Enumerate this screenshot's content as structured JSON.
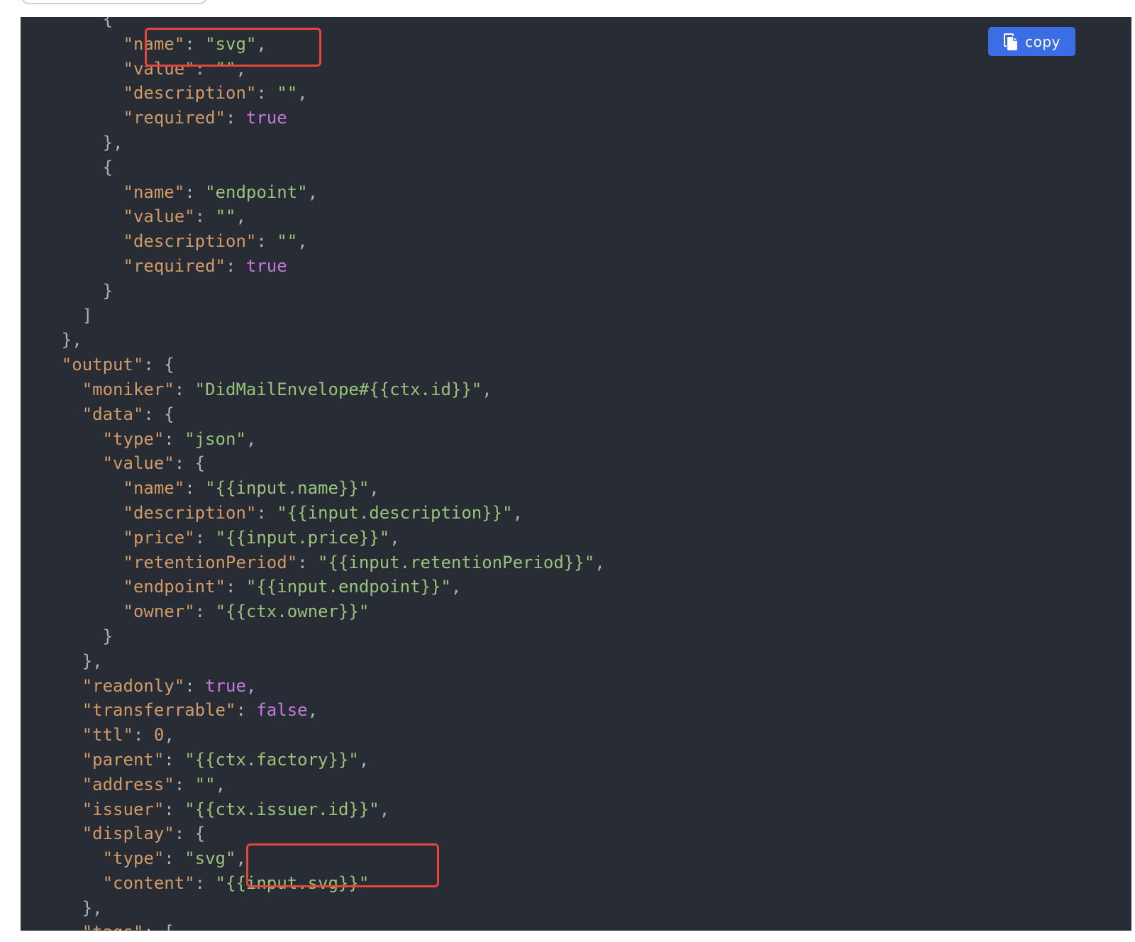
{
  "copy_button": {
    "label": "copy",
    "icon": "copy-icon",
    "color": "#3b6ee6"
  },
  "highlight_color": "#e8443a",
  "code": {
    "language": "json",
    "lines": [
      [
        {
          "t": "p",
          "v": "        {"
        }
      ],
      [
        {
          "t": "p",
          "v": "          "
        },
        {
          "t": "k",
          "v": "\"name\""
        },
        {
          "t": "p",
          "v": ": "
        },
        {
          "t": "s",
          "v": "\"svg\""
        },
        {
          "t": "p",
          "v": ","
        }
      ],
      [
        {
          "t": "p",
          "v": "          "
        },
        {
          "t": "k",
          "v": "\"value\""
        },
        {
          "t": "p",
          "v": ": "
        },
        {
          "t": "s",
          "v": "\"\""
        },
        {
          "t": "p",
          "v": ","
        }
      ],
      [
        {
          "t": "p",
          "v": "          "
        },
        {
          "t": "k",
          "v": "\"description\""
        },
        {
          "t": "p",
          "v": ": "
        },
        {
          "t": "s",
          "v": "\"\""
        },
        {
          "t": "p",
          "v": ","
        }
      ],
      [
        {
          "t": "p",
          "v": "          "
        },
        {
          "t": "k",
          "v": "\"required\""
        },
        {
          "t": "p",
          "v": ": "
        },
        {
          "t": "b",
          "v": "true"
        }
      ],
      [
        {
          "t": "p",
          "v": "        },"
        }
      ],
      [
        {
          "t": "p",
          "v": "        {"
        }
      ],
      [
        {
          "t": "p",
          "v": "          "
        },
        {
          "t": "k",
          "v": "\"name\""
        },
        {
          "t": "p",
          "v": ": "
        },
        {
          "t": "s",
          "v": "\"endpoint\""
        },
        {
          "t": "p",
          "v": ","
        }
      ],
      [
        {
          "t": "p",
          "v": "          "
        },
        {
          "t": "k",
          "v": "\"value\""
        },
        {
          "t": "p",
          "v": ": "
        },
        {
          "t": "s",
          "v": "\"\""
        },
        {
          "t": "p",
          "v": ","
        }
      ],
      [
        {
          "t": "p",
          "v": "          "
        },
        {
          "t": "k",
          "v": "\"description\""
        },
        {
          "t": "p",
          "v": ": "
        },
        {
          "t": "s",
          "v": "\"\""
        },
        {
          "t": "p",
          "v": ","
        }
      ],
      [
        {
          "t": "p",
          "v": "          "
        },
        {
          "t": "k",
          "v": "\"required\""
        },
        {
          "t": "p",
          "v": ": "
        },
        {
          "t": "b",
          "v": "true"
        }
      ],
      [
        {
          "t": "p",
          "v": "        }"
        }
      ],
      [
        {
          "t": "p",
          "v": "      ]"
        }
      ],
      [
        {
          "t": "p",
          "v": "    },"
        }
      ],
      [
        {
          "t": "p",
          "v": "    "
        },
        {
          "t": "k",
          "v": "\"output\""
        },
        {
          "t": "p",
          "v": ": {"
        }
      ],
      [
        {
          "t": "p",
          "v": "      "
        },
        {
          "t": "k",
          "v": "\"moniker\""
        },
        {
          "t": "p",
          "v": ": "
        },
        {
          "t": "s",
          "v": "\"DidMailEnvelope#{{ctx.id}}\""
        },
        {
          "t": "p",
          "v": ","
        }
      ],
      [
        {
          "t": "p",
          "v": "      "
        },
        {
          "t": "k",
          "v": "\"data\""
        },
        {
          "t": "p",
          "v": ": {"
        }
      ],
      [
        {
          "t": "p",
          "v": "        "
        },
        {
          "t": "k",
          "v": "\"type\""
        },
        {
          "t": "p",
          "v": ": "
        },
        {
          "t": "s",
          "v": "\"json\""
        },
        {
          "t": "p",
          "v": ","
        }
      ],
      [
        {
          "t": "p",
          "v": "        "
        },
        {
          "t": "k",
          "v": "\"value\""
        },
        {
          "t": "p",
          "v": ": {"
        }
      ],
      [
        {
          "t": "p",
          "v": "          "
        },
        {
          "t": "k",
          "v": "\"name\""
        },
        {
          "t": "p",
          "v": ": "
        },
        {
          "t": "s",
          "v": "\"{{input.name}}\""
        },
        {
          "t": "p",
          "v": ","
        }
      ],
      [
        {
          "t": "p",
          "v": "          "
        },
        {
          "t": "k",
          "v": "\"description\""
        },
        {
          "t": "p",
          "v": ": "
        },
        {
          "t": "s",
          "v": "\"{{input.description}}\""
        },
        {
          "t": "p",
          "v": ","
        }
      ],
      [
        {
          "t": "p",
          "v": "          "
        },
        {
          "t": "k",
          "v": "\"price\""
        },
        {
          "t": "p",
          "v": ": "
        },
        {
          "t": "s",
          "v": "\"{{input.price}}\""
        },
        {
          "t": "p",
          "v": ","
        }
      ],
      [
        {
          "t": "p",
          "v": "          "
        },
        {
          "t": "k",
          "v": "\"retentionPeriod\""
        },
        {
          "t": "p",
          "v": ": "
        },
        {
          "t": "s",
          "v": "\"{{input.retentionPeriod}}\""
        },
        {
          "t": "p",
          "v": ","
        }
      ],
      [
        {
          "t": "p",
          "v": "          "
        },
        {
          "t": "k",
          "v": "\"endpoint\""
        },
        {
          "t": "p",
          "v": ": "
        },
        {
          "t": "s",
          "v": "\"{{input.endpoint}}\""
        },
        {
          "t": "p",
          "v": ","
        }
      ],
      [
        {
          "t": "p",
          "v": "          "
        },
        {
          "t": "k",
          "v": "\"owner\""
        },
        {
          "t": "p",
          "v": ": "
        },
        {
          "t": "s",
          "v": "\"{{ctx.owner}}\""
        }
      ],
      [
        {
          "t": "p",
          "v": "        }"
        }
      ],
      [
        {
          "t": "p",
          "v": "      },"
        }
      ],
      [
        {
          "t": "p",
          "v": "      "
        },
        {
          "t": "k",
          "v": "\"readonly\""
        },
        {
          "t": "p",
          "v": ": "
        },
        {
          "t": "b",
          "v": "true"
        },
        {
          "t": "p",
          "v": ","
        }
      ],
      [
        {
          "t": "p",
          "v": "      "
        },
        {
          "t": "k",
          "v": "\"transferrable\""
        },
        {
          "t": "p",
          "v": ": "
        },
        {
          "t": "b",
          "v": "false"
        },
        {
          "t": "p",
          "v": ","
        }
      ],
      [
        {
          "t": "p",
          "v": "      "
        },
        {
          "t": "k",
          "v": "\"ttl\""
        },
        {
          "t": "p",
          "v": ": "
        },
        {
          "t": "n",
          "v": "0"
        },
        {
          "t": "p",
          "v": ","
        }
      ],
      [
        {
          "t": "p",
          "v": "      "
        },
        {
          "t": "k",
          "v": "\"parent\""
        },
        {
          "t": "p",
          "v": ": "
        },
        {
          "t": "s",
          "v": "\"{{ctx.factory}}\""
        },
        {
          "t": "p",
          "v": ","
        }
      ],
      [
        {
          "t": "p",
          "v": "      "
        },
        {
          "t": "k",
          "v": "\"address\""
        },
        {
          "t": "p",
          "v": ": "
        },
        {
          "t": "s",
          "v": "\"\""
        },
        {
          "t": "p",
          "v": ","
        }
      ],
      [
        {
          "t": "p",
          "v": "      "
        },
        {
          "t": "k",
          "v": "\"issuer\""
        },
        {
          "t": "p",
          "v": ": "
        },
        {
          "t": "s",
          "v": "\"{{ctx.issuer.id}}\""
        },
        {
          "t": "p",
          "v": ","
        }
      ],
      [
        {
          "t": "p",
          "v": "      "
        },
        {
          "t": "k",
          "v": "\"display\""
        },
        {
          "t": "p",
          "v": ": {"
        }
      ],
      [
        {
          "t": "p",
          "v": "        "
        },
        {
          "t": "k",
          "v": "\"type\""
        },
        {
          "t": "p",
          "v": ": "
        },
        {
          "t": "s",
          "v": "\"svg\""
        },
        {
          "t": "p",
          "v": ","
        }
      ],
      [
        {
          "t": "p",
          "v": "        "
        },
        {
          "t": "k",
          "v": "\"content\""
        },
        {
          "t": "p",
          "v": ": "
        },
        {
          "t": "s",
          "v": "\"{{input.svg}}\""
        }
      ],
      [
        {
          "t": "p",
          "v": "      },"
        }
      ],
      [
        {
          "t": "p",
          "v": "      "
        },
        {
          "t": "k",
          "v": "\"tags\""
        },
        {
          "t": "p",
          "v": ": ["
        }
      ]
    ]
  }
}
